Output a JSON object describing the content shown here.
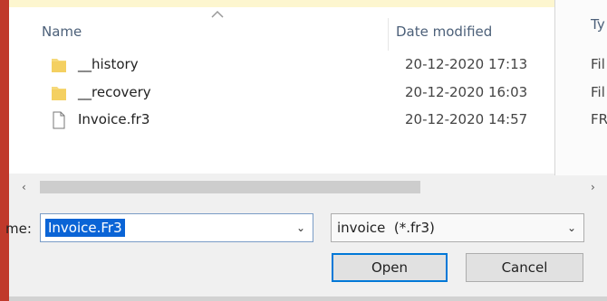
{
  "columns": {
    "name": "Name",
    "date": "Date modified",
    "type": "Ty"
  },
  "files": [
    {
      "name": "__history",
      "date": "20-12-2020 17:13",
      "type": "Fil",
      "kind": "folder"
    },
    {
      "name": "__recovery",
      "date": "20-12-2020 16:03",
      "type": "Fil",
      "kind": "folder"
    },
    {
      "name": "Invoice.fr3",
      "date": "20-12-2020 14:57",
      "type": "FR",
      "kind": "file"
    }
  ],
  "scrollbar": {
    "left_arrow": "‹",
    "right_arrow": "›"
  },
  "file_name": {
    "label": "me:",
    "value": "Invoice.Fr3",
    "caret": "⌄"
  },
  "file_type": {
    "value": "invoice  (*.fr3)",
    "caret": "⌄"
  },
  "buttons": {
    "open": "Open",
    "cancel": "Cancel"
  }
}
